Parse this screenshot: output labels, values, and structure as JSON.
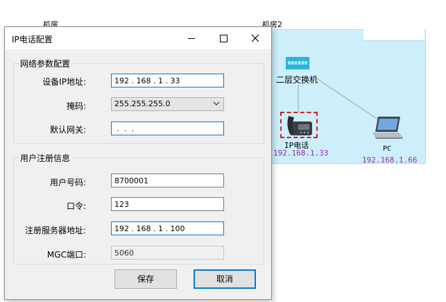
{
  "canvas": {
    "room1_label": "机房",
    "room2_label": "机房2",
    "switch_label": "二层交换机",
    "phone_name": "IP电话",
    "phone_ip": "192.168.1.33",
    "pc_name": "PC",
    "pc_ip": "192.168.1.66",
    "colors": {
      "room_fill": "#cdeefb",
      "ip_text": "#9b2db0",
      "selection": "#d02020",
      "switch": "#2bb3d9"
    }
  },
  "dialog": {
    "title": "IP电话配置",
    "network_group": {
      "title": "网络参数配置",
      "ip_label": "设备IP地址:",
      "ip_value": "192 . 168 . 1 . 33",
      "mask_label": "掩码:",
      "mask_value": "255.255.255.0",
      "gateway_label": "默认网关:",
      "gateway_value": " .  .  . "
    },
    "user_group": {
      "title": "用户注册信息",
      "user_label": "用户号码:",
      "user_value": "8700001",
      "password_label": "口令:",
      "password_value": "123",
      "server_label": "注册服务器地址:",
      "server_value": "192 . 168 . 1 . 100",
      "mgc_label": "MGC端口:",
      "mgc_value": "5060"
    },
    "save_label": "保存",
    "cancel_label": "取消"
  }
}
